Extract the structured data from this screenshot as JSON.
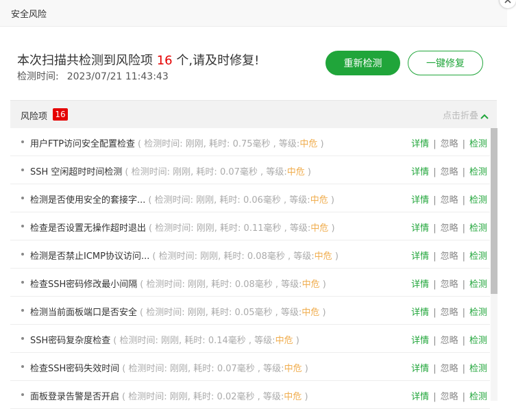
{
  "dialog": {
    "title": "安全风险"
  },
  "summary": {
    "prefix": "本次扫描共检测到风险项",
    "count": "16",
    "suffix": "个,请及时修复!",
    "time_label": "检测时间:",
    "time_value": "2023/07/21 11:43:43"
  },
  "buttons": {
    "rescan": "重新检测",
    "fix_all": "一键修复"
  },
  "panel": {
    "label": "风险项",
    "badge": "16",
    "collapse": "点击折叠"
  },
  "labels": {
    "meta_prefix": "( 检测时间:",
    "meta_elapsed": "刚刚, 耗时:",
    "meta_level": "等级:",
    "meta_close": ")",
    "action_detail": "详情",
    "action_ignore": "忽略",
    "action_check": "检测",
    "separator": "|"
  },
  "items": [
    {
      "name": "用户FTP访问安全配置检查",
      "duration": "0.75毫秒",
      "level": "中危"
    },
    {
      "name": "SSH 空闲超时时间检测",
      "duration": "0.07毫秒",
      "level": "中危"
    },
    {
      "name": "检测是否使用安全的套接字...",
      "duration": "0.06毫秒",
      "level": "中危"
    },
    {
      "name": "检查是否设置无操作超时退出",
      "duration": "0.11毫秒",
      "level": "中危"
    },
    {
      "name": "检测是否禁止ICMP协议访问...",
      "duration": "0.08毫秒",
      "level": "中危"
    },
    {
      "name": "检查SSH密码修改最小间隔",
      "duration": "0.08毫秒",
      "level": "中危"
    },
    {
      "name": "检测当前面板端口是否安全",
      "duration": "0.05毫秒",
      "level": "中危"
    },
    {
      "name": "SSH密码复杂度检查",
      "duration": "0.14毫秒",
      "level": "中危"
    },
    {
      "name": "检查SSH密码失效时间",
      "duration": "0.07毫秒",
      "level": "中危"
    },
    {
      "name": "面板登录告警是否开启",
      "duration": "0.02毫秒",
      "level": "中危"
    }
  ],
  "colors": {
    "accent": "#20a53a",
    "danger": "#e50000",
    "warning": "#f0ad4e"
  },
  "icons": {
    "close": "close-icon",
    "collapse": "chevron-up-icon"
  }
}
